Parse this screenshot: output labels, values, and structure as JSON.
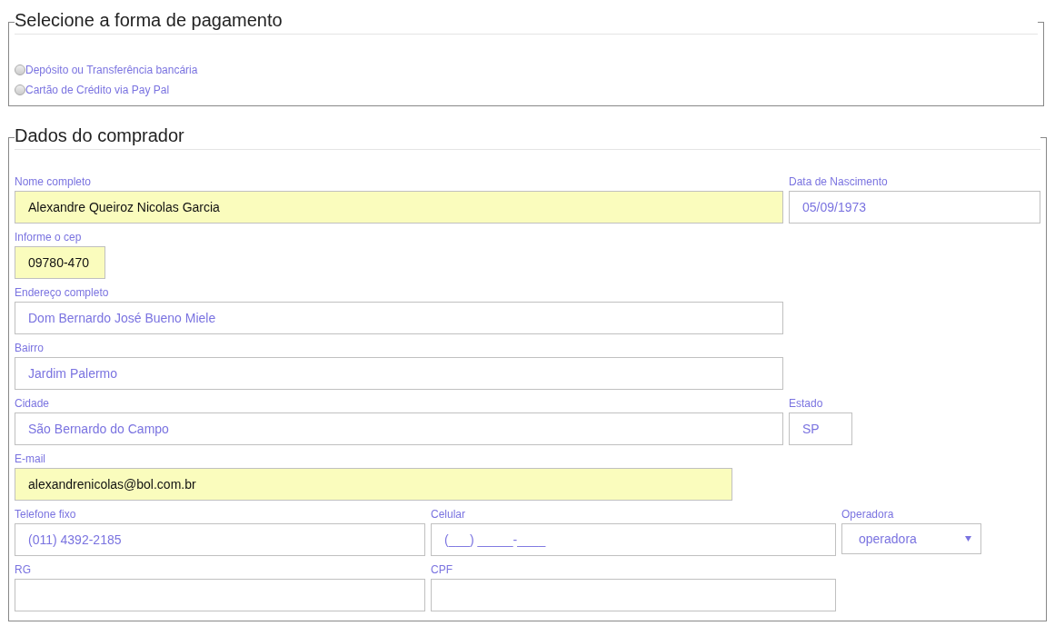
{
  "payment": {
    "title": "Selecione a forma de pagamento",
    "options": [
      {
        "label": "Depósito ou Transferência bancária",
        "selected": false
      },
      {
        "label": "Cartão de Crédito via Pay Pal",
        "selected": false
      }
    ]
  },
  "buyer": {
    "title": "Dados do comprador",
    "rows": [
      {
        "fields": [
          {
            "kind": "text",
            "label": "Nome completo",
            "value": "Alexandre Queiroz Nicolas Garcia"
          },
          {
            "kind": "text",
            "label": "Data de Nascimento",
            "placeholder": "05/09/1973"
          }
        ]
      },
      {
        "fields": [
          {
            "kind": "text",
            "label": "Informe o cep",
            "value": "09780-470"
          }
        ]
      },
      {
        "fields": [
          {
            "kind": "text",
            "label": "Endereço completo",
            "placeholder": "Dom Bernardo José Bueno Miele"
          }
        ]
      },
      {
        "fields": [
          {
            "kind": "text",
            "label": "Bairro",
            "placeholder": "Jardim Palermo"
          }
        ]
      },
      {
        "fields": [
          {
            "kind": "text",
            "label": "Cidade",
            "placeholder": "São Bernardo do Campo"
          },
          {
            "kind": "text",
            "label": "Estado",
            "placeholder": "SP"
          }
        ]
      },
      {
        "fields": [
          {
            "kind": "text",
            "label": "E-mail",
            "value": "alexandrenicolas@bol.com.br"
          }
        ]
      },
      {
        "fields": [
          {
            "kind": "text",
            "label": "Telefone fixo",
            "placeholder": "(011) 4392-2185"
          },
          {
            "kind": "text",
            "label": "Celular",
            "placeholder": "(___) _____-____"
          },
          {
            "kind": "select",
            "label": "Operadora",
            "value": "operadora"
          }
        ]
      },
      {
        "fields": [
          {
            "kind": "text",
            "label": "RG"
          },
          {
            "kind": "text",
            "label": "CPF"
          }
        ]
      }
    ]
  }
}
